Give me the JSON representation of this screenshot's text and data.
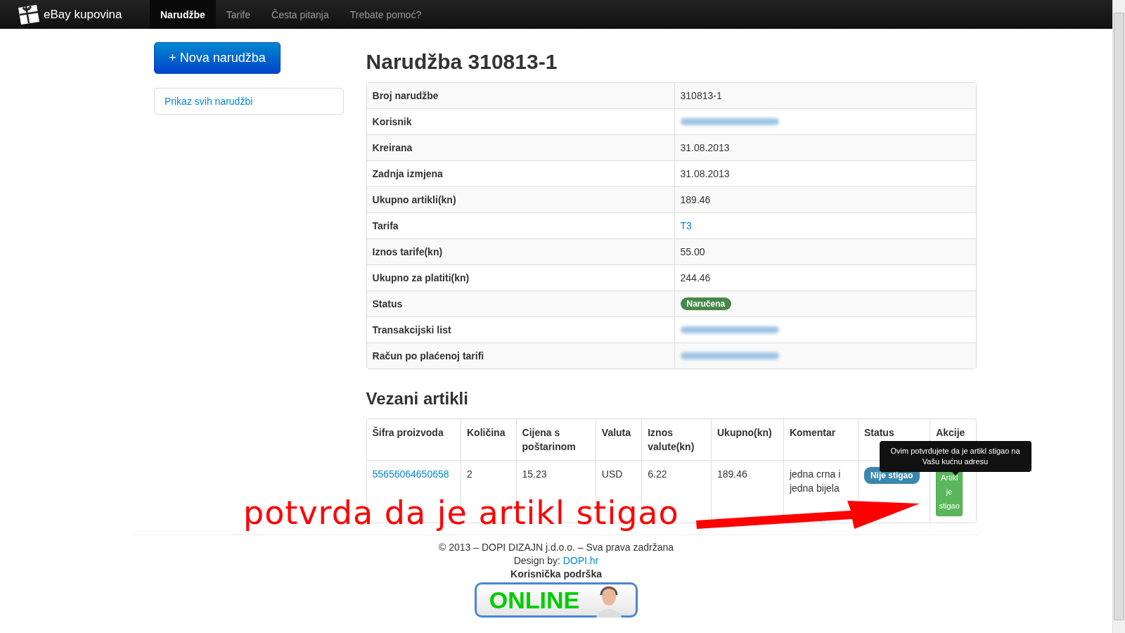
{
  "navbar": {
    "brand": "eBay kupovina",
    "items": [
      {
        "label": "Narudžbe",
        "selected": true
      },
      {
        "label": "Tarife",
        "selected": false
      },
      {
        "label": "Česta pitanja",
        "selected": false
      },
      {
        "label": "Trebate pomoć?",
        "selected": false
      }
    ]
  },
  "sidebar": {
    "new_button": "+ Nova narudžba",
    "links": [
      "Prikaz svih narudžbi"
    ]
  },
  "order": {
    "title": "Narudžba 310813-1",
    "rows": [
      {
        "label": "Broj narudžbe",
        "kind": "text",
        "value": "310813-1"
      },
      {
        "label": "Korisnik",
        "kind": "blurred"
      },
      {
        "label": "Kreirana",
        "kind": "text",
        "value": "31.08.2013"
      },
      {
        "label": "Zadnja izmjena",
        "kind": "text",
        "value": "31.08.2013"
      },
      {
        "label": "Ukupno artikli(kn)",
        "kind": "text",
        "value": "189.46"
      },
      {
        "label": "Tarifa",
        "kind": "link",
        "value": "T3"
      },
      {
        "label": "Iznos tarife(kn)",
        "kind": "text",
        "value": "55.00"
      },
      {
        "label": "Ukupno za platiti(kn)",
        "kind": "text",
        "value": "244.46"
      },
      {
        "label": "Status",
        "kind": "badge",
        "value": "Naručena",
        "color": "#468847"
      },
      {
        "label": "Transakcijski list",
        "kind": "blurred"
      },
      {
        "label": "Račun po plaćenoj tarifi",
        "kind": "blurred"
      }
    ]
  },
  "items": {
    "title": "Vezani artikli",
    "columns": [
      "Šifra proizvoda",
      "Količina",
      "Cijena s poštarinom",
      "Valuta",
      "Iznos valute(kn)",
      "Ukupno(kn)",
      "Komentar",
      "Status",
      "Akcije"
    ],
    "rows": [
      {
        "code": "55656064650658",
        "quantity": "2",
        "price": "15.23",
        "currency": "USD",
        "amount": "6.22",
        "total": "189.46",
        "comment": "jedna crna i jedna bijela",
        "status": "Nije stigao",
        "color": "#3a87ad",
        "action": "Artikl je stigao"
      }
    ],
    "tooltip": "Ovim potvrđujete da je artikl stigao na Vašu kućnu adresu"
  },
  "annotation": "potvrda da je artikl stigao",
  "footer": {
    "copyright": "© 2013 – DOPI DIZAJN j.d.o.o. – Sva prava zadržana",
    "design_label": "Design by:",
    "design_link": "DOPI.hr",
    "support": "Korisnička podrška",
    "online_button": "ONLINE"
  }
}
